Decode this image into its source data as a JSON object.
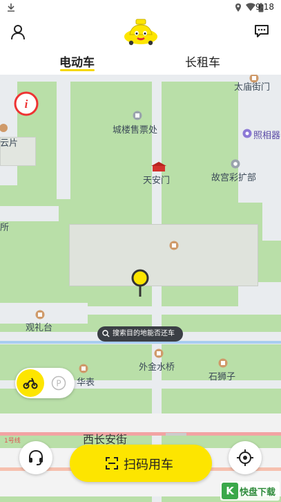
{
  "status_bar": {
    "time": "9:18"
  },
  "tabs": [
    {
      "label": "电动车",
      "active": true
    },
    {
      "label": "长租车",
      "active": false
    }
  ],
  "map": {
    "search_tip": "搜索目的地能否还车",
    "pois": {
      "tiananmen_ticket": "城楼售票处",
      "tiananmen": "天安门",
      "taimiao": "太庙街门",
      "photo": "照相器",
      "palace_print": "故宫彩扩部",
      "guanlitai": "观礼台",
      "jinshui": "外金水桥",
      "lions": "石狮子",
      "huabiao": "华表",
      "chang_an": "西长安街",
      "left_partial_1": "云片",
      "left_partial_2": "所",
      "metro_line": "1号线"
    }
  },
  "buttons": {
    "scan": "扫码用车"
  },
  "watermark": {
    "text": "快盘下载"
  },
  "colors": {
    "accent": "#fde500",
    "map_green": "#b9dfa8",
    "road": "#e9ecef"
  }
}
